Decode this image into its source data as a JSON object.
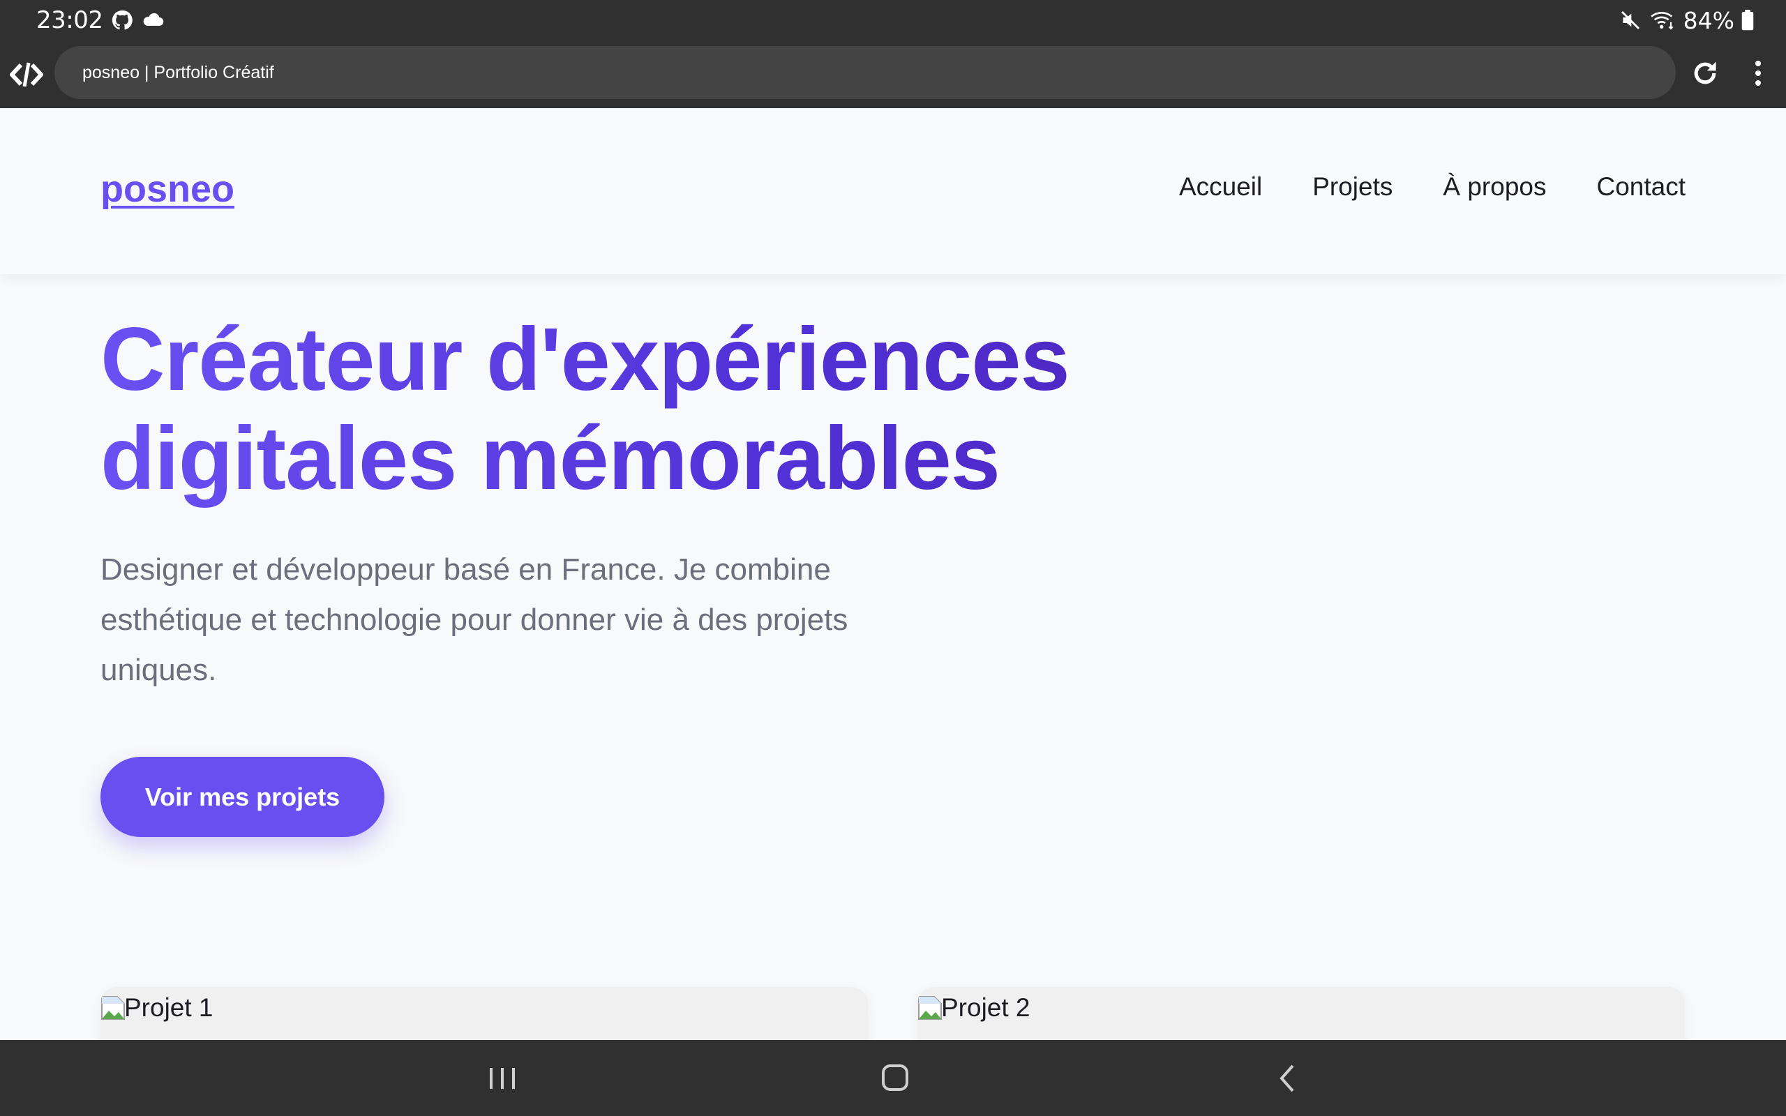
{
  "status_bar": {
    "time": "23:02",
    "battery_text": "84%",
    "left_icons": [
      "github-icon",
      "cloud-icon"
    ],
    "right_icons": [
      "mute-icon",
      "wifi-icon",
      "battery-icon"
    ]
  },
  "browser": {
    "url_title": "posneo | Portfolio Créatif",
    "icons": [
      "app-logo-icon",
      "reload-icon",
      "more-vert-icon"
    ]
  },
  "site": {
    "brand": "posneo",
    "nav": [
      "Accueil",
      "Projets",
      "À propos",
      "Contact"
    ],
    "hero": {
      "title_line1": "Créateur d'expériences",
      "title_line2": "digitales mémorables",
      "description": "Designer et développeur basé en France. Je combine esthétique et technologie pour donner vie à des projets uniques.",
      "cta": "Voir mes projets"
    },
    "projects": [
      {
        "alt": "Projet 1"
      },
      {
        "alt": "Projet 2"
      }
    ]
  },
  "nav_bar": {
    "icons": [
      "recents-icon",
      "home-icon",
      "back-icon"
    ]
  },
  "colors": {
    "accent": "#6a4ff0",
    "gradient_end": "#4a22b8",
    "system_bar": "#303030",
    "page_bg": "#f8f9fb"
  }
}
